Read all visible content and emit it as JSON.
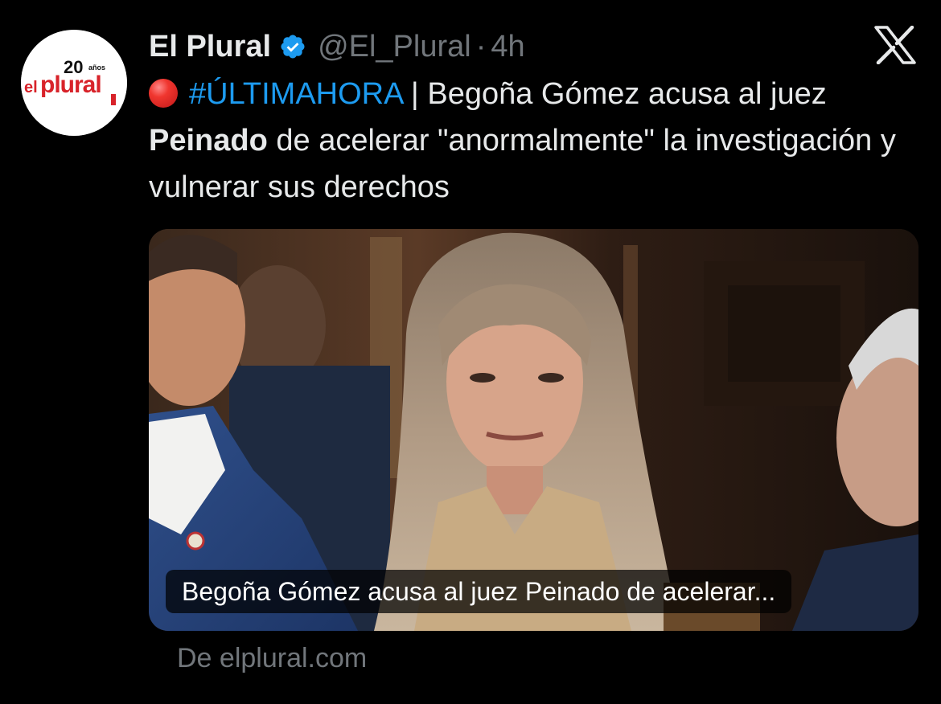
{
  "tweet": {
    "avatar": {
      "logo_text_el": "el",
      "logo_text_plural": "plural",
      "logo_text_20": "20",
      "logo_text_anos": "años",
      "icon": "el-plural-logo"
    },
    "display_name": "El Plural",
    "verified_icon": "verified-badge-icon",
    "handle": "@El_Plural",
    "separator": "·",
    "time": "4h",
    "brand_icon": "x-logo-icon",
    "text": {
      "emoji_icon": "red-circle-emoji",
      "hashtag": "#ÚLTIMAHORA",
      "part1": " | Begoña Gómez acusa al juez ",
      "bold": "Peinado",
      "part2": " de acelerar \"anormalmente\" la investigación y vulnerar sus derechos"
    },
    "card": {
      "image_icon": "news-photo",
      "caption": "Begoña Gómez acusa al juez Peinado de acelerar...",
      "source": "De elplural.com"
    }
  },
  "colors": {
    "background": "#000000",
    "text": "#e7e9ea",
    "secondary": "#71767b",
    "link": "#1d9bf0",
    "verified": "#1d9bf0",
    "logo_red": "#d8232a"
  }
}
